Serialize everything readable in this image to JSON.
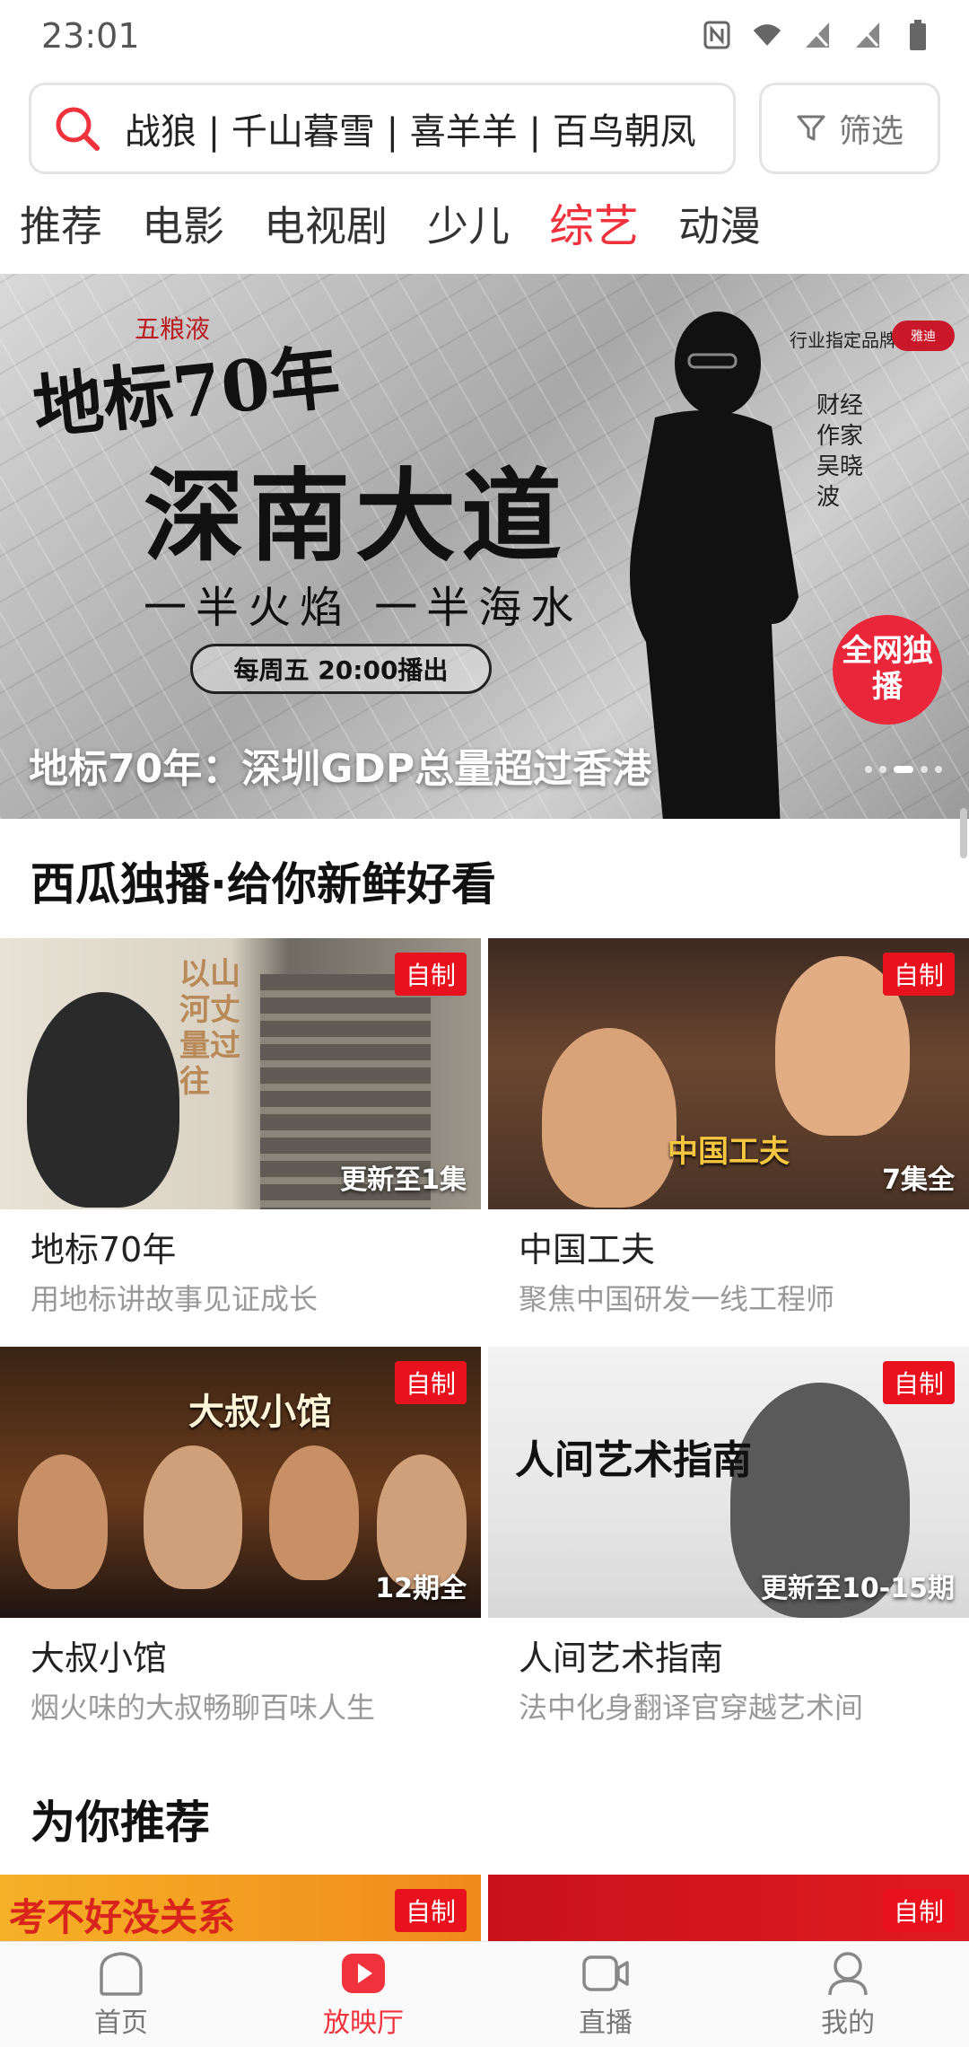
{
  "status_bar": {
    "time": "23:01"
  },
  "search": {
    "placeholder": "战狼 | 千山暮雪 | 喜羊羊 | 百鸟朝凤",
    "filter_label": "筛选"
  },
  "tabs": [
    {
      "label": "推荐",
      "active": false
    },
    {
      "label": "电影",
      "active": false
    },
    {
      "label": "电视剧",
      "active": false
    },
    {
      "label": "少儿",
      "active": false
    },
    {
      "label": "综艺",
      "active": true
    },
    {
      "label": "动漫",
      "active": false
    }
  ],
  "banner": {
    "logo_main": "地标70年",
    "logo_sub": "五粮液",
    "headline": "深南大道",
    "slogan": "一半火焰 一半海水",
    "schedule": "每周五 20:00播出",
    "brand_line": "行业指定品牌",
    "brand_badge": "雅迪",
    "author": "财经作家 吴晓波",
    "exclusive_badge": "全网独播",
    "caption": "地标70年：深圳GDP总量超过香港",
    "dot_count": 5,
    "active_dot": 2
  },
  "section_exclusive": {
    "title": "西瓜独播·给你新鲜好看",
    "cards": [
      {
        "title": "地标70年",
        "subtitle": "用地标讲故事见证成长",
        "tag": "自制",
        "count": "更新至1集",
        "thumb_text": "以山河丈量过往"
      },
      {
        "title": "中国工夫",
        "subtitle": "聚焦中国研发一线工程师",
        "tag": "自制",
        "count": "7集全",
        "thumb_text": "中国工夫"
      },
      {
        "title": "大叔小馆",
        "subtitle": "烟火味的大叔畅聊百味人生",
        "tag": "自制",
        "count": "12期全",
        "thumb_text": "大叔小馆"
      },
      {
        "title": "人间艺术指南",
        "subtitle": "法中化身翻译官穿越艺术间",
        "tag": "自制",
        "count": "更新至10-15期",
        "thumb_text": "人间艺术指南"
      }
    ]
  },
  "section_recommend": {
    "title": "为你推荐",
    "cards": [
      {
        "tag": "自制",
        "thumb_text": "考不好没关系"
      },
      {
        "tag": "自制"
      }
    ]
  },
  "bottom_nav": [
    {
      "label": "首页",
      "icon": "home-icon",
      "active": false
    },
    {
      "label": "放映厅",
      "icon": "play-icon",
      "active": true
    },
    {
      "label": "直播",
      "icon": "live-camera-icon",
      "active": false
    },
    {
      "label": "我的",
      "icon": "profile-icon",
      "active": false
    }
  ],
  "colors": {
    "accent": "#f0323c",
    "tag_red": "#e8121e",
    "muted_text": "#999999"
  }
}
